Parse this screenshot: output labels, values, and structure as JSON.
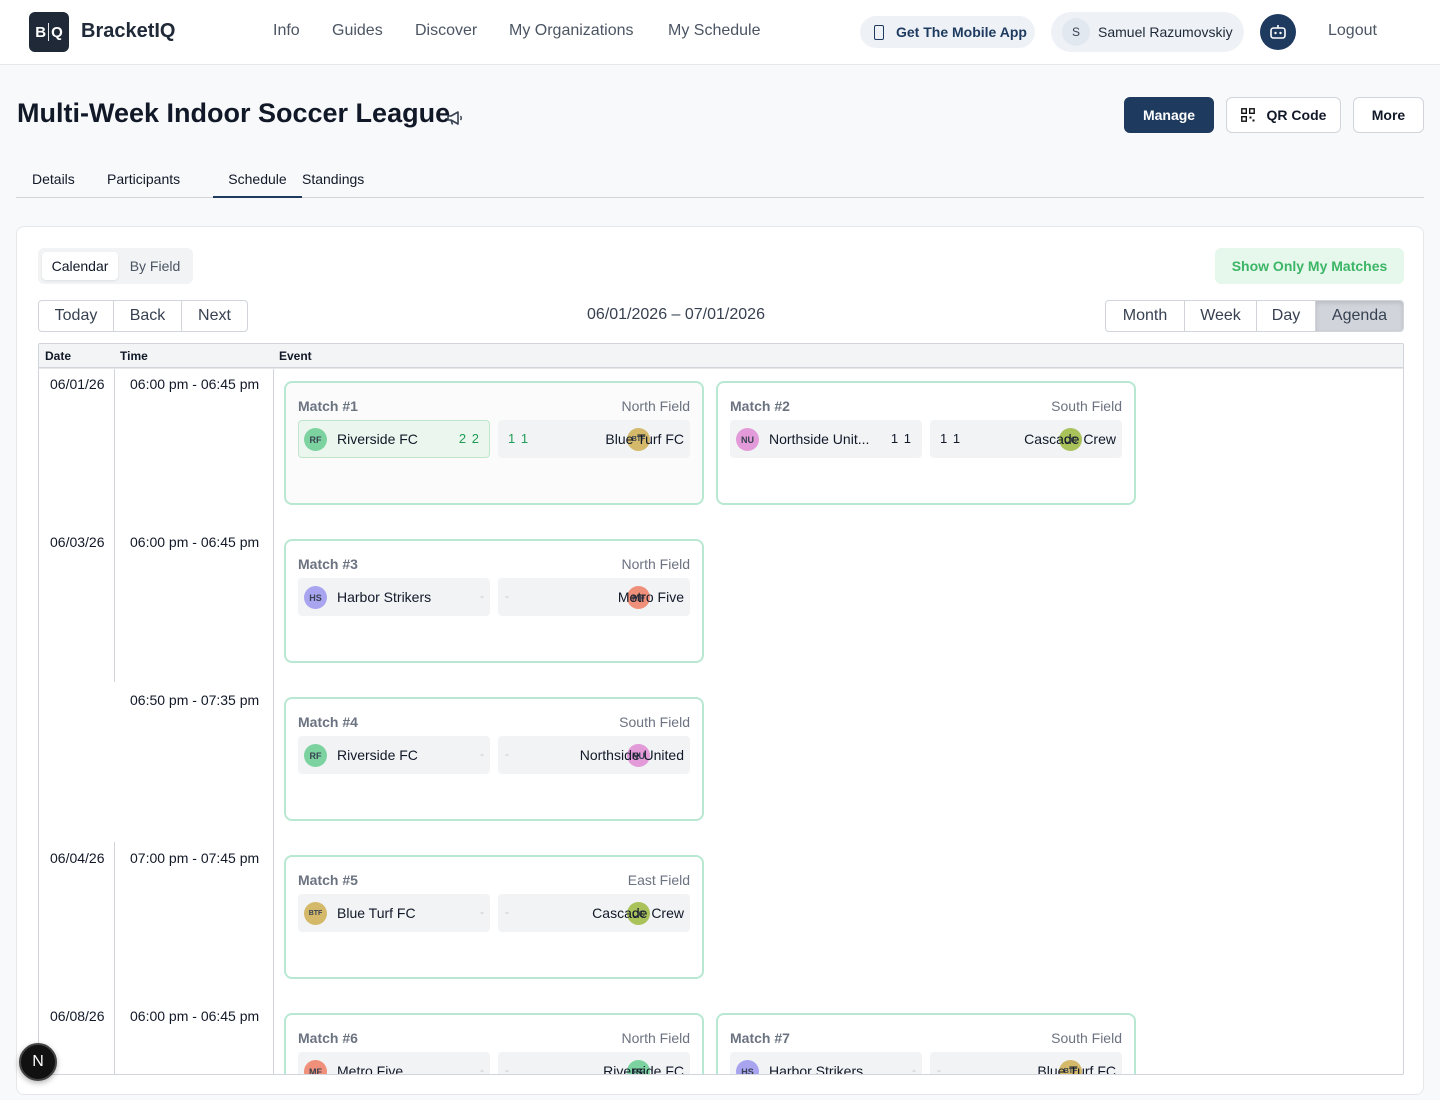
{
  "header": {
    "logo": "B|Q",
    "logo_left": "B",
    "logo_right": "Q",
    "brand": "BracketIQ",
    "nav": [
      "Info",
      "Guides",
      "Discover",
      "My Organizations",
      "My Schedule"
    ],
    "mobile_app": "Get The Mobile App",
    "user_initial": "S",
    "user_name": "Samuel Razumovskiy",
    "logout": "Logout"
  },
  "page": {
    "title": "Multi-Week Indoor Soccer League",
    "manage": "Manage",
    "qr_code": "QR Code",
    "more": "More",
    "tabs": [
      "Details",
      "Participants",
      "Schedule",
      "Standings"
    ],
    "active_tab": "Schedule"
  },
  "schedule": {
    "view_toggle": [
      "Calendar",
      "By Field"
    ],
    "show_only_mine": "Show Only My Matches",
    "nav_buttons": [
      "Today",
      "Back",
      "Next"
    ],
    "range": "06/01/2026 – 07/01/2026",
    "views": [
      "Month",
      "Week",
      "Day",
      "Agenda"
    ],
    "active_view": "Agenda",
    "headers": {
      "date": "Date",
      "time": "Time",
      "event": "Event"
    },
    "rows": [
      {
        "date": "06/01/26",
        "time": "06:00 pm - 06:45 pm"
      },
      {
        "date": "06/03/26",
        "time": "06:00 pm - 06:45 pm"
      },
      {
        "date": "",
        "time": "06:50 pm - 07:35 pm"
      },
      {
        "date": "06/04/26",
        "time": "07:00 pm - 07:45 pm"
      },
      {
        "date": "06/08/26",
        "time": "06:00 pm - 06:45 pm"
      }
    ],
    "matches": [
      {
        "title": "Match #1",
        "field": "North Field",
        "home": {
          "abbr": "RF",
          "name": "Riverside FC",
          "score": "2 2"
        },
        "away": {
          "abbr": "BTF",
          "name": "Blue Turf FC",
          "score": "1 1"
        }
      },
      {
        "title": "Match #2",
        "field": "South Field",
        "home": {
          "abbr": "NU",
          "name": "Northside Unit...",
          "score": "1 1"
        },
        "away": {
          "abbr": "CC",
          "name": "Cascade Crew",
          "score": "1 1"
        }
      },
      {
        "title": "Match #3",
        "field": "North Field",
        "home": {
          "abbr": "HS",
          "name": "Harbor Strikers",
          "score": "-"
        },
        "away": {
          "abbr": "MF",
          "name": "Metro Five",
          "score": "-"
        }
      },
      {
        "title": "Match #4",
        "field": "South Field",
        "home": {
          "abbr": "RF",
          "name": "Riverside FC",
          "score": "-"
        },
        "away": {
          "abbr": "NU",
          "name": "Northside United",
          "score": "-"
        }
      },
      {
        "title": "Match #5",
        "field": "East Field",
        "home": {
          "abbr": "BTF",
          "name": "Blue Turf FC",
          "score": "-"
        },
        "away": {
          "abbr": "CC",
          "name": "Cascade Crew",
          "score": "-"
        }
      },
      {
        "title": "Match #6",
        "field": "North Field",
        "home": {
          "abbr": "MF",
          "name": "Metro Five",
          "score": "-"
        },
        "away": {
          "abbr": "RF",
          "name": "Riverside FC",
          "score": "-"
        }
      },
      {
        "title": "Match #7",
        "field": "South Field",
        "home": {
          "abbr": "HS",
          "name": "Harbor Strikers",
          "score": "-"
        },
        "away": {
          "abbr": "BTF",
          "name": "Blue Turf FC",
          "score": "-"
        }
      }
    ],
    "team_colors": {
      "RF": "#7dd3a0",
      "BTF": "#d4b96a",
      "NU": "#e39ad8",
      "CC": "#a9c25a",
      "HS": "#a9a4f0",
      "MF": "#f0907a"
    }
  },
  "floating": {
    "label": "N"
  }
}
